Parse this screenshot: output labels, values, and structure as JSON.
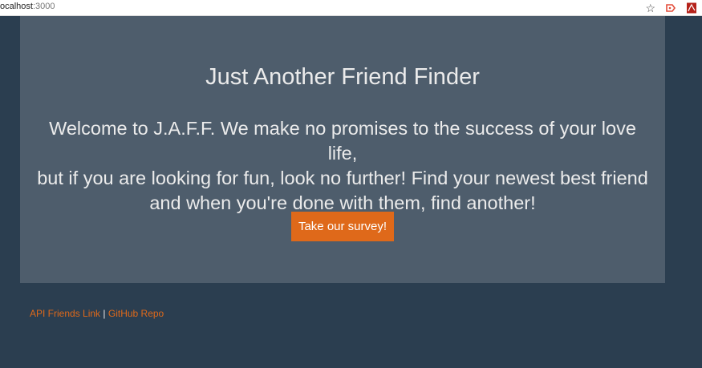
{
  "browser": {
    "url_host": "ocalhost",
    "url_port": ":3000",
    "icons": [
      "star-icon",
      "extension-arrow-icon",
      "pdf-icon"
    ]
  },
  "jumbotron": {
    "title": "Just Another Friend Finder",
    "lines": [
      "Welcome to J.A.F.F. We make no promises to the success of your love life,",
      "but if you are looking for fun, look no further! Find your newest best friend",
      "and when you're done with them, find another!"
    ],
    "button_label": "Take our survey!"
  },
  "footer": {
    "api_link": "API Friends Link",
    "separator": "|",
    "github_link": "GitHub Repo"
  },
  "colors": {
    "background": "#2b3e50",
    "panel": "#4e5d6c",
    "accent": "#df691a",
    "text": "#ebebeb"
  }
}
